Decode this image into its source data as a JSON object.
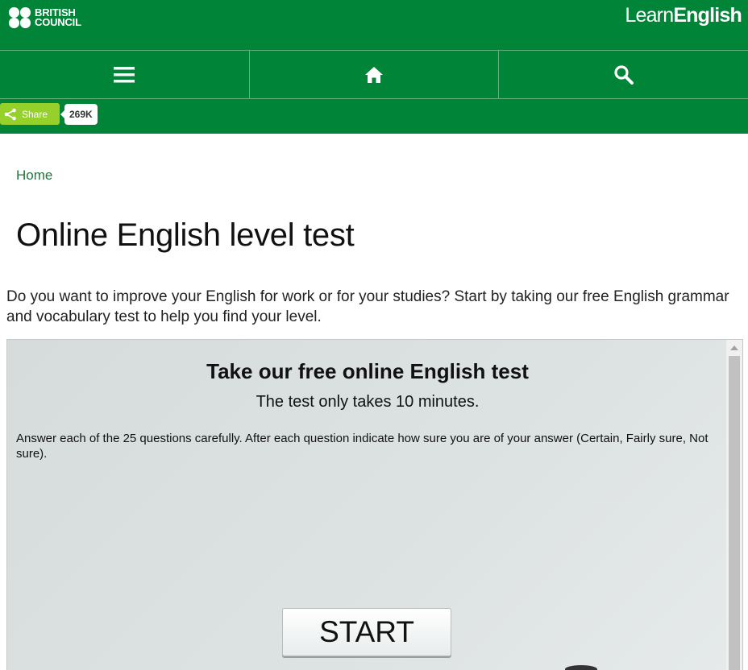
{
  "header": {
    "logo_line1": "BRITISH",
    "logo_line2": "COUNCIL",
    "site_name_light": "Learn",
    "site_name_bold": "English",
    "brand_color": "#008437"
  },
  "nav": {
    "menu_icon": "hamburger-menu-icon",
    "home_icon": "home-icon",
    "search_icon": "search-icon"
  },
  "share": {
    "label": "Share",
    "count": "269K",
    "button_color": "#95d12a"
  },
  "breadcrumb": {
    "home": "Home"
  },
  "page": {
    "title": "Online English level test",
    "intro": "Do you want to improve your English for work or for your studies? Start by taking our free English grammar and vocabulary test to help you find your level."
  },
  "test": {
    "heading": "Take our free online English test",
    "subheading": "The test only takes 10 minutes.",
    "instructions": "Answer each of the 25 questions carefully. After each question indicate how sure you are of your answer (Certain, Fairly sure, Not sure).",
    "start_label": "START"
  }
}
